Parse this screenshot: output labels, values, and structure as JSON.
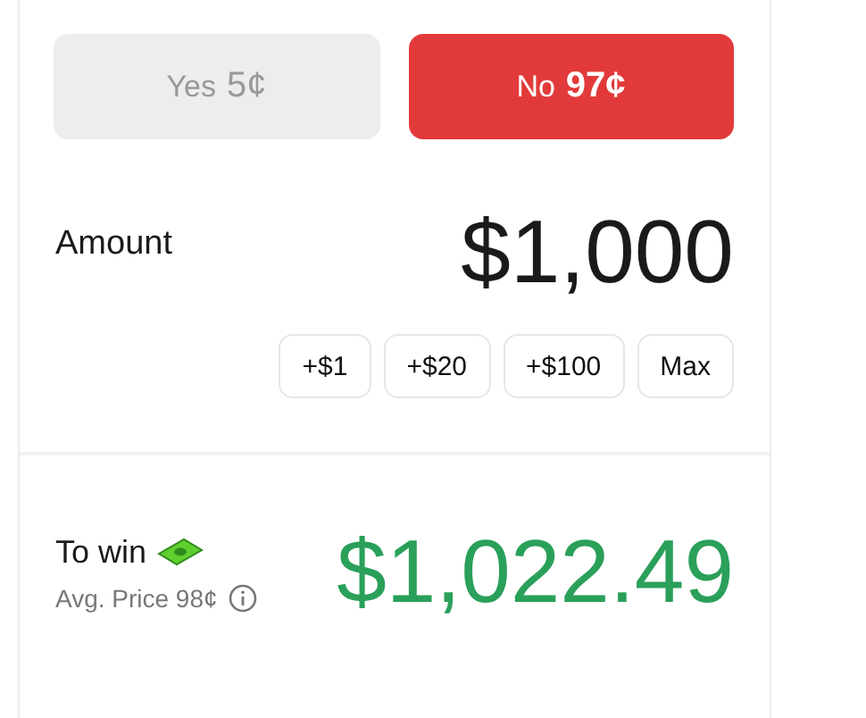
{
  "outcomes": [
    {
      "label": "Yes",
      "price": "5¢",
      "selected": false
    },
    {
      "label": "No",
      "price": "97¢",
      "selected": true
    }
  ],
  "amount": {
    "label": "Amount",
    "value": "$1,000"
  },
  "increments": [
    "+$1",
    "+$20",
    "+$100",
    "Max"
  ],
  "payout": {
    "label": "To win",
    "avg_price": "Avg. Price 98¢",
    "value": "$1,022.49"
  }
}
